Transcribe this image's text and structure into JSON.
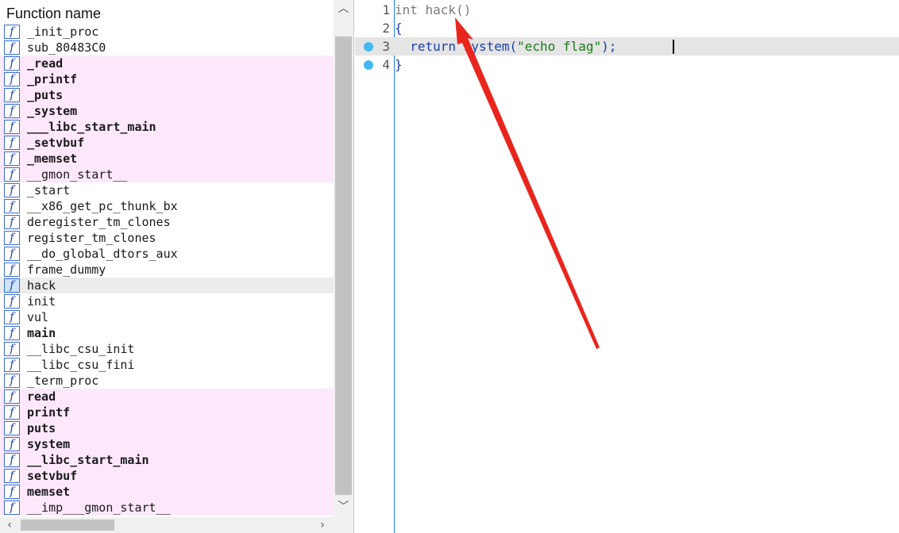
{
  "function_list": {
    "header": "Function name",
    "items": [
      {
        "name": "_init_proc",
        "style": "normal"
      },
      {
        "name": "sub_80483C0",
        "style": "normal"
      },
      {
        "name": "_read",
        "style": "import-bold"
      },
      {
        "name": "_printf",
        "style": "import-bold"
      },
      {
        "name": "_puts",
        "style": "import-bold"
      },
      {
        "name": "_system",
        "style": "import-bold"
      },
      {
        "name": "___libc_start_main",
        "style": "import-bold"
      },
      {
        "name": "_setvbuf",
        "style": "import-bold"
      },
      {
        "name": "_memset",
        "style": "import-bold"
      },
      {
        "name": "__gmon_start__",
        "style": "import"
      },
      {
        "name": "_start",
        "style": "normal"
      },
      {
        "name": "__x86_get_pc_thunk_bx",
        "style": "normal"
      },
      {
        "name": "deregister_tm_clones",
        "style": "normal"
      },
      {
        "name": "register_tm_clones",
        "style": "normal"
      },
      {
        "name": "__do_global_dtors_aux",
        "style": "normal"
      },
      {
        "name": "frame_dummy",
        "style": "normal"
      },
      {
        "name": "hack",
        "style": "selected"
      },
      {
        "name": "init",
        "style": "normal"
      },
      {
        "name": "vul",
        "style": "normal"
      },
      {
        "name": "main",
        "style": "bold"
      },
      {
        "name": "__libc_csu_init",
        "style": "normal"
      },
      {
        "name": "__libc_csu_fini",
        "style": "normal"
      },
      {
        "name": "_term_proc",
        "style": "normal"
      },
      {
        "name": "read",
        "style": "import-bold"
      },
      {
        "name": "printf",
        "style": "import-bold"
      },
      {
        "name": "puts",
        "style": "import-bold"
      },
      {
        "name": "system",
        "style": "import-bold"
      },
      {
        "name": "__libc_start_main",
        "style": "import-bold"
      },
      {
        "name": "setvbuf",
        "style": "import-bold"
      },
      {
        "name": "memset",
        "style": "import-bold"
      },
      {
        "name": "__imp___gmon_start__",
        "style": "import"
      }
    ],
    "icon_glyph": "f",
    "icon_name": "function-icon"
  },
  "scrollbars": {
    "up_glyph": "︿",
    "down_glyph": "﹀",
    "left_glyph": "‹",
    "right_glyph": "›"
  },
  "code": {
    "current_line": 3,
    "lines": [
      {
        "num": "1",
        "breakpoint": false,
        "tokens": [
          {
            "t": "int hack()",
            "c": "type"
          }
        ]
      },
      {
        "num": "2",
        "breakpoint": false,
        "tokens": [
          {
            "t": "{",
            "c": "plain"
          }
        ]
      },
      {
        "num": "3",
        "breakpoint": true,
        "tokens": [
          {
            "t": "  return system(",
            "c": "plain"
          },
          {
            "t": "\"echo flag\"",
            "c": "str"
          },
          {
            "t": ");",
            "c": "plain"
          }
        ]
      },
      {
        "num": "4",
        "breakpoint": true,
        "tokens": [
          {
            "t": "}",
            "c": "plain"
          }
        ]
      }
    ]
  },
  "annotation": {
    "arrow_color": "#e8261e"
  }
}
